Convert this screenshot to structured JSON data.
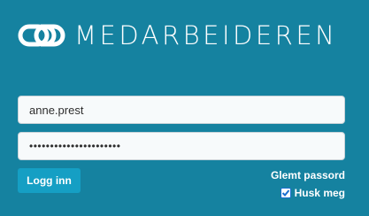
{
  "brand": {
    "name": "MEDARBEIDEREN",
    "logo_icon": "chain-link-icon"
  },
  "login": {
    "username_value": "anne.prest",
    "password_value": "••••••••••••••••••••••",
    "submit_label": "Logg inn",
    "forgot_label": "Glemt passord",
    "remember_label": "Husk meg",
    "remember_checked": true
  },
  "colors": {
    "background": "#1582a0",
    "button": "#159fc4",
    "field": "#f7fafb"
  }
}
